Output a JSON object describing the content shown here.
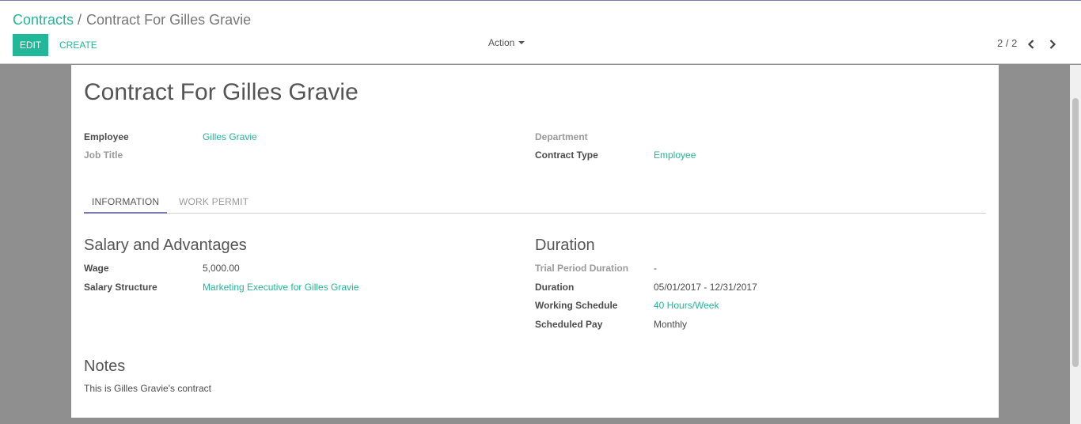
{
  "breadcrumb": {
    "root": "Contracts",
    "separator": "/",
    "current": "Contract For Gilles Gravie"
  },
  "toolbar": {
    "edit_label": "EDIT",
    "create_label": "CREATE",
    "action_label": "Action"
  },
  "pager": {
    "value": "2 / 2",
    "prev_icon": "chevron-left-icon",
    "next_icon": "chevron-right-icon"
  },
  "colors": {
    "accent": "#21b799",
    "brand": "#7c7bad",
    "backdrop": "#8f8f8f"
  },
  "form": {
    "title": "Contract For Gilles Gravie",
    "employee": {
      "label": "Employee",
      "value": "Gilles Gravie"
    },
    "job_title": {
      "label": "Job Title",
      "value": ""
    },
    "department": {
      "label": "Department",
      "value": ""
    },
    "contract_type": {
      "label": "Contract Type",
      "value": "Employee"
    }
  },
  "tabs": [
    {
      "label": "INFORMATION",
      "active": true
    },
    {
      "label": "WORK PERMIT",
      "active": false
    }
  ],
  "salary": {
    "title": "Salary and Advantages",
    "wage": {
      "label": "Wage",
      "value": "5,000.00"
    },
    "structure": {
      "label": "Salary Structure",
      "value": "Marketing Executive for Gilles Gravie"
    }
  },
  "duration": {
    "title": "Duration",
    "trial": {
      "label": "Trial Period Duration",
      "value": "-"
    },
    "duration": {
      "label": "Duration",
      "value": "05/01/2017 - 12/31/2017"
    },
    "schedule": {
      "label": "Working Schedule",
      "value": "40 Hours/Week"
    },
    "scheduled_pay": {
      "label": "Scheduled Pay",
      "value": "Monthly"
    }
  },
  "notes": {
    "title": "Notes",
    "text": "This is Gilles Gravie's contract"
  }
}
